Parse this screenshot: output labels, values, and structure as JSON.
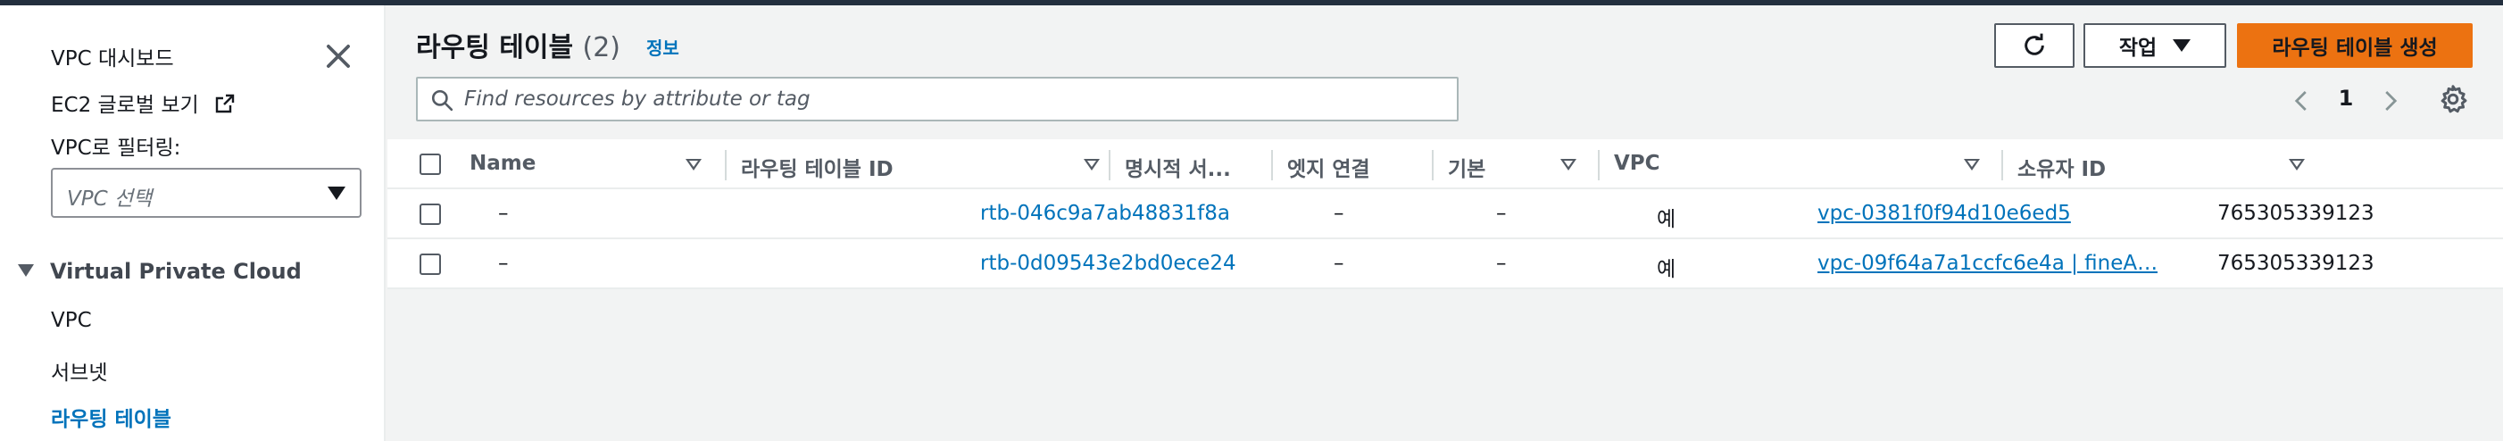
{
  "sidebar": {
    "dashboard": "VPC 대시보드",
    "ec2_global_view": "EC2 글로벌 보기",
    "filter_label": "VPC로 필터링:",
    "vpc_select_placeholder": "VPC 선택",
    "section_title": "Virtual Private Cloud",
    "items": [
      {
        "label": "VPC"
      },
      {
        "label": "서브넷"
      },
      {
        "label": "라우팅 테이블",
        "active": true
      }
    ]
  },
  "header": {
    "title": "라우팅 테이블",
    "count": "(2)",
    "info_link": "정보",
    "actions_label": "작업",
    "create_label": "라우팅 테이블 생성"
  },
  "search": {
    "placeholder": "Find resources by attribute or tag"
  },
  "pagination": {
    "current_page": "1"
  },
  "table": {
    "columns": [
      "Name",
      "라우팅 테이블 ID",
      "명시적 서...",
      "엣지 연결",
      "기본",
      "VPC",
      "소유자 ID"
    ],
    "rows": [
      {
        "name": "–",
        "route_table_id": "rtb-046c9a7ab48831f8a",
        "explicit_subnet": "–",
        "edge_association": "–",
        "main": "예",
        "vpc": "vpc-0381f0f94d10e6ed5",
        "owner_id": "765305339123"
      },
      {
        "name": "–",
        "route_table_id": "rtb-0d09543e2bd0ece24",
        "explicit_subnet": "–",
        "edge_association": "–",
        "main": "예",
        "vpc": "vpc-09f64a7a1ccfc6e4a | fineA…",
        "owner_id": "765305339123"
      }
    ]
  },
  "colors": {
    "link": "#0073bb",
    "primary_button": "#ec7211",
    "top_bar": "#232f3e",
    "page_background": "#f2f3f3"
  },
  "icons": [
    "close-icon",
    "external-link-icon",
    "caret-down-icon",
    "refresh-icon",
    "search-icon",
    "chevron-left-icon",
    "chevron-right-icon",
    "gear-icon",
    "sort-icon"
  ]
}
